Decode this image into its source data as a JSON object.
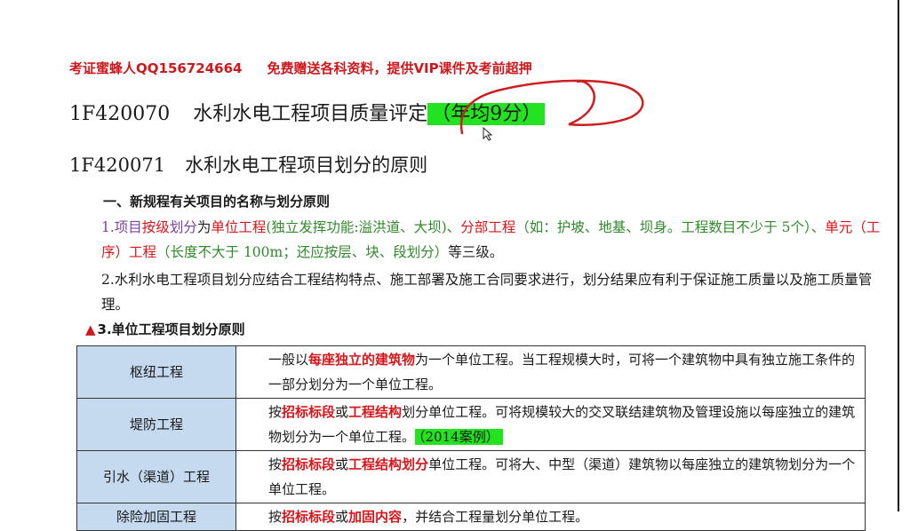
{
  "banner": {
    "left": "考证蜜蜂人QQ156724664",
    "right": "免费赠送各科资料，提供VIP课件及考前超押"
  },
  "heading1": {
    "code": "1F420070",
    "title": "水利水电工程项目质量评定",
    "highlight": "（年均9分）"
  },
  "heading2": {
    "code": "1F420071",
    "title": "水利水电工程项目划分的原则"
  },
  "section1": {
    "title": "一、新规程有关项目的名称与划分原则"
  },
  "para1": {
    "a": "1.项目",
    "b": "按级",
    "c": "划分",
    "d": "为",
    "e": "单位工程",
    "f": "(独立发挥功能:溢洪道、大坝)、",
    "g": "分部工程",
    "h": "（如：护坡、地基、坝身。工程数目不少于 5个）、",
    "i": "单元（工序）工程",
    "j": "（长度不大于 100m；还应按层、块、段划分）",
    "k": "等三级。"
  },
  "para2": "2.水利水电工程项目划分应结合工程结构特点、施工部署及施工合同要求进行，划分结果应有利于保证施工质量以及施工质量管理。",
  "subsection": {
    "marker": "▲",
    "title": "3.单位工程项目划分原则"
  },
  "table": {
    "rows": [
      {
        "key": "枢纽工程",
        "t1": "一般以",
        "r1": "每座独立的建筑物",
        "t2": "为一个单位工程。当工程规模大时，可将一个建筑物中具有独立施工条件的一部分划分为一个单位工程。"
      },
      {
        "key": "堤防工程",
        "t1": "按",
        "r1": "招标标段",
        "t2": "或",
        "r2": "工程结构",
        "t3": "划分单位工程。可将规模较大的交叉联结建筑物及管理设施以每座独立的建筑物划分为一个单位工程。",
        "case": "（2014案例）"
      },
      {
        "key": "引水（渠道）工程",
        "t1": "按",
        "r1": "招标标段",
        "t2": "或",
        "r2": "工程结构划分",
        "t3": "单位工程。可将大、中型（渠道）建筑物以每座独立的建筑物划分为一个单位工程。"
      },
      {
        "key": "除险加固工程",
        "t1": "按",
        "r1": "招标标段",
        "t2": "或",
        "r2": "加固内容",
        "t3": "，并结合工程量划分单位工程。"
      }
    ]
  }
}
